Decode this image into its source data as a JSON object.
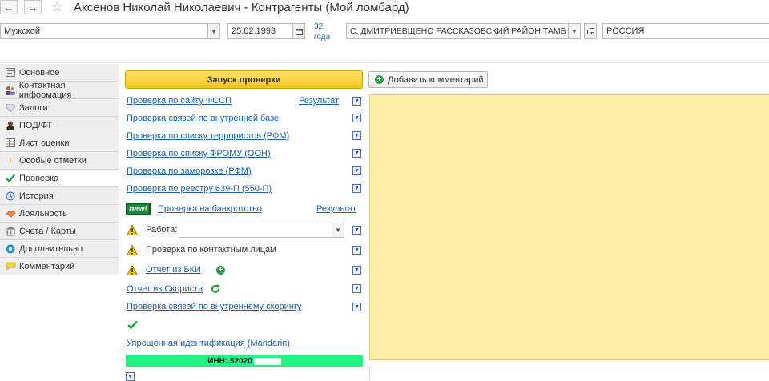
{
  "window": {
    "title": "Аксенов Николай Николаевич - Контрагенты (Мой ломбард)",
    "back_icon": "arrow-left",
    "forward_icon": "arrow-right",
    "favorite_icon": "star-outline"
  },
  "header": {
    "gender_value": "Мужской",
    "birth_date_value": "25.02.1993",
    "age_value": "32",
    "age_unit": "года",
    "birthplace_value": "С. ДМИТРИЕВЩЕНО РАССКАЗОВСКИЙ РАЙОН ТАМБ",
    "country_value": "РОССИЯ"
  },
  "sidebar": {
    "items": [
      {
        "label": "Основное",
        "icon": "form-icon"
      },
      {
        "label": "Контактная информация",
        "icon": "contacts-icon"
      },
      {
        "label": "Залоги",
        "icon": "diamond-icon"
      },
      {
        "label": "ПОД/ФТ",
        "icon": "person-icon"
      },
      {
        "label": "Лист оценки",
        "icon": "table-icon"
      },
      {
        "label": "Особые отметки",
        "icon": "exclamation-icon"
      },
      {
        "label": "Проверка",
        "icon": "checkmark-icon"
      },
      {
        "label": "История",
        "icon": "history-icon"
      },
      {
        "label": "Лояльность",
        "icon": "loyalty-icon"
      },
      {
        "label": "Счета / Карты",
        "icon": "bank-icon"
      },
      {
        "label": "Дополнительно",
        "icon": "gear-icon"
      },
      {
        "label": "Комментарий",
        "icon": "comment-icon"
      }
    ],
    "active_index": 6
  },
  "checks": {
    "run_button_label": "Запуск проверки",
    "fssp": {
      "label": "Проверка по сайту ФССП",
      "result_label": "Результат"
    },
    "internal_links": "Проверка связей по внутренней базе",
    "terrorists": "Проверка по списку террористов (РФМ)",
    "fromu": "Проверка по списку ФРОМУ (ООН)",
    "freeze": "Проверка по заморозке (РФМ)",
    "registry": "Проверка по реестру 639-П (550-П)",
    "bankruptcy": {
      "badge": "new!",
      "label": "Проверка на банкротство",
      "result_label": "Результат"
    },
    "work_label": "Работа:",
    "work_value": "",
    "contacts_check": "Проверка по контактным лицам",
    "bki_report": "Отчет из БКИ",
    "scorista_report": "Отчет из Скориста",
    "internal_scoring": "Проверка связей по внутреннему скорингу",
    "mandarin": "Упрощенная идентификация (Mandarin)",
    "inn_text": "ИНН: 52020"
  },
  "comments": {
    "add_button_label": "Добавить комментарий",
    "value": ""
  }
}
